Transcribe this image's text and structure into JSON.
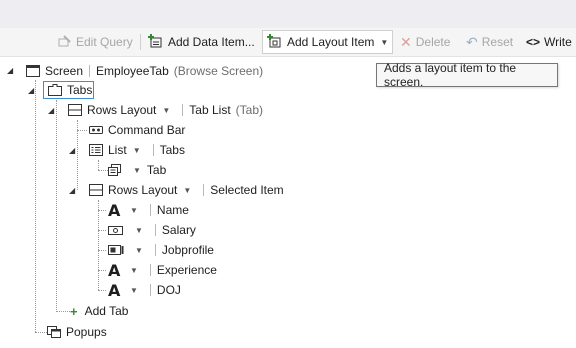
{
  "toolbar": {
    "edit_query": "Edit Query",
    "add_data_item": "Add Data Item...",
    "add_layout_item": "Add Layout Item",
    "delete": "Delete",
    "reset": "Reset",
    "write": "Write"
  },
  "tooltip": "Adds a layout item to the screen.",
  "tree": {
    "screen_label": "Screen",
    "screen_name": "EmployeeTab",
    "screen_type": "(Browse Screen)",
    "tabs": "Tabs",
    "rows_layout": "Rows Layout",
    "tab_list": "Tab List",
    "tab_list_type": "(Tab)",
    "command_bar": "Command Bar",
    "list": "List",
    "list_source": "Tabs",
    "tab": "Tab",
    "rows_layout2": "Rows Layout",
    "selected_item": "Selected Item",
    "fields": [
      {
        "name": "Name",
        "icon": "text-icon"
      },
      {
        "name": "Salary",
        "icon": "money-icon"
      },
      {
        "name": "Jobprofile",
        "icon": "picker-icon"
      },
      {
        "name": "Experience",
        "icon": "text-icon"
      },
      {
        "name": "DOJ",
        "icon": "text-icon"
      }
    ],
    "add_tab": "Add Tab",
    "popups": "Popups"
  },
  "colors": {
    "accent": "#3b8ed6",
    "toolbar_bg": "#f5f5f5",
    "add_green": "#3a8a3a"
  }
}
